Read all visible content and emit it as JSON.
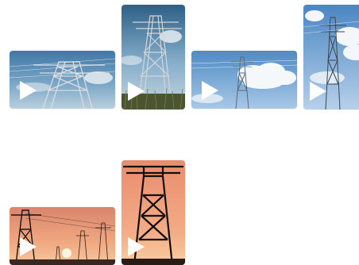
{
  "gallery": {
    "items": [
      {
        "kind": "video",
        "subject": "transmission-tower",
        "sky": "blue"
      },
      {
        "kind": "video",
        "subject": "transmission-tower",
        "sky": "blue"
      },
      {
        "kind": "video",
        "subject": "transmission-tower",
        "sky": "blue-clouds"
      },
      {
        "kind": "video",
        "subject": "transmission-tower",
        "sky": "blue-clouds"
      },
      {
        "kind": "video",
        "subject": "transmission-tower",
        "sky": "sunset"
      },
      {
        "kind": "video",
        "subject": "transmission-tower",
        "sky": "sunset"
      }
    ]
  },
  "colors": {
    "play_icon": "#ffffff",
    "sky_blue": "#6f9fc8",
    "sky_light": "#bcd6ee",
    "sunset_top": "#e98c6e",
    "sunset_bottom": "#f6c7a0",
    "tower_dark": "#1b1410",
    "grass": "#3d4a2a"
  }
}
